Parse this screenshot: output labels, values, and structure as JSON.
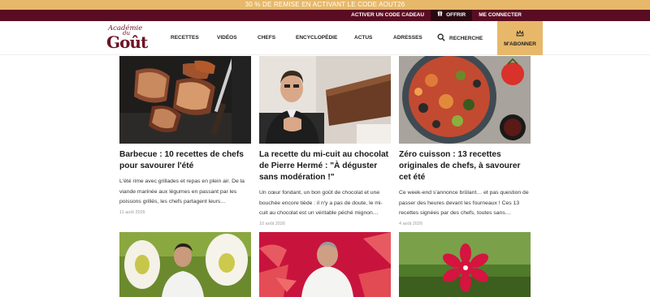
{
  "promo": {
    "text": "30 % DE REMISE EN ACTIVANT LE CODE AOUT26"
  },
  "topbar": {
    "activate": "ACTIVER UN CODE CADEAU",
    "gift": "OFFRIR",
    "login": "ME CONNECTER"
  },
  "logo": {
    "line1": "Académie",
    "line2": "du",
    "line3": "Goût"
  },
  "nav": {
    "items": [
      "RECETTES",
      "VIDÉOS",
      "CHEFS",
      "ENCYCLOPÉDIE",
      "ACTUS",
      "ADRESSES"
    ],
    "search": "RECHERCHE",
    "subscribe": "M'ABONNER"
  },
  "cards": [
    {
      "title": "Barbecue : 10 recettes de chefs pour savourer l'été",
      "excerpt": "L'été rime avec grillades et repas en plein air. De la viande marinée aux légumes en passant par les poissons grillés, les chefs partagent leurs…",
      "date": "11 août 2026"
    },
    {
      "title": "La recette du mi-cuit au chocolat de Pierre Hermé : \"À déguster sans modération !\"",
      "excerpt": "Un cœur fondant, un bon goût de chocolat et une bouchée encore tiède : il n'y a pas de doute, le mi-cuit au chocolat est un véritable péché mignon…",
      "date": "10 août 2026"
    },
    {
      "title": "Zéro cuisson : 13 recettes originales de chefs, à savourer cet été",
      "excerpt": "Ce week-end s'annonce brûlant… et pas question de passer des heures devant les fourneaux ! Ces 13 recettes signées par des chefs, toutes sans…",
      "date": "4 août 2026"
    }
  ],
  "colors": {
    "promo": "#e7b86a",
    "topbar": "#5a0d22",
    "brand": "#6b1324",
    "subscribe": "#e7b86a"
  },
  "icons": {
    "gift": "gift-icon",
    "search": "search-icon",
    "subscribe": "crown-icon"
  }
}
